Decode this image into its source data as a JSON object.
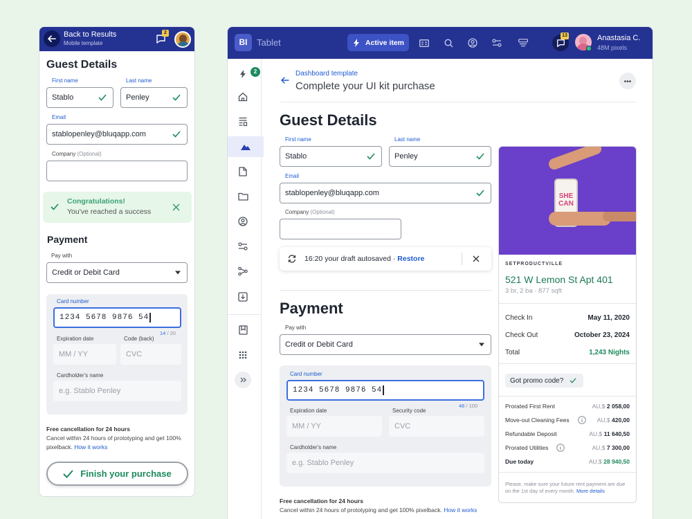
{
  "mobile": {
    "header": {
      "back_label": "Back to Results",
      "subtitle": "Mobile template",
      "badge": "2"
    },
    "title": "Guest Details",
    "form": {
      "first_name_label": "First name",
      "first_name": "Stablo",
      "last_name_label": "Last name",
      "last_name": "Penley",
      "email_label": "Email",
      "email": "stablopenley@bluqapp.com",
      "company_label": "Company",
      "company_optional": "(Optional)"
    },
    "alert": {
      "title": "Congratulations!",
      "message": "You've reached a success"
    },
    "payment": {
      "title": "Payment",
      "pay_with_label": "Pay with",
      "pay_with": "Credit or Debit Card",
      "card_number_label": "Card number",
      "card_number": "1234 5678 9876 54",
      "counter_current": "14",
      "counter_total": "/ 20",
      "expiration_label": "Expiration date",
      "expiration_placeholder": "MM / YY",
      "code_label": "Code (back)",
      "code_placeholder": "CVC",
      "cardholder_label": "Cardholder's name",
      "cardholder_placeholder": "e.g. Stablo Penley"
    },
    "cancellation": {
      "title": "Free cancellation for 24 hours",
      "text": "Cancel within 24 hours of prototyping and get 100% pixelback.",
      "link": "How it works"
    },
    "finish_label": "Finish your purchase"
  },
  "tablet": {
    "header": {
      "logo": "BI",
      "app_name": "Tablet",
      "active_label": "Active item",
      "badge": "13",
      "user_name": "Anastasia C.",
      "user_sub": "48M pixels"
    },
    "sidebar": {
      "badge": "2"
    },
    "breadcrumb": "Dashboard template",
    "page_title": "Complete your UI kit purchase",
    "title": "Guest Details",
    "form": {
      "first_name_label": "First name",
      "first_name": "Stablo",
      "last_name_label": "Last name",
      "last_name": "Penley",
      "email_label": "Email",
      "email": "stablopenley@bluqapp.com",
      "company_label": "Company",
      "company_optional": "(Optional)"
    },
    "autosave": {
      "text": "16:20 your draft autosaved ·",
      "restore": "Restore"
    },
    "payment": {
      "title": "Payment",
      "pay_with_label": "Pay with",
      "pay_with": "Credit or Debit Card",
      "card_number_label": "Card number",
      "card_number": "1234 5678 9876 54",
      "counter_current": "48",
      "counter_total": "/ 100",
      "expiration_label": "Expiration date",
      "expiration_placeholder": "MM / YY",
      "security_label": "Security code",
      "security_placeholder": "CVC",
      "cardholder_label": "Cardholder's name",
      "cardholder_placeholder": "e.g. Stablo Penley"
    },
    "cancellation": {
      "title": "Free cancellation for 24 hours",
      "text": "Cancel within 24 hours of prototyping and get 100% pixelback.",
      "link": "How it works"
    },
    "property": {
      "can_text_1": "SHE",
      "can_text_2": "CAN",
      "brand": "SETPRODUCTVILLE",
      "address": "521 W Lemon St Apt 401",
      "details": "3 br, 2 ba · 877 sqft",
      "check_in_label": "Check In",
      "check_in": "May 11, 2020",
      "check_out_label": "Check Out",
      "check_out": "October 23, 2024",
      "total_label": "Total",
      "total": "1,243 Nights",
      "promo_label": "Got promo code?",
      "fees": [
        {
          "label": "Prorated First Rent",
          "currency": "AU,$",
          "amount": "2 058,00"
        },
        {
          "label": "Move-out Cleaning Fees",
          "currency": "AU,$",
          "amount": "420,00"
        },
        {
          "label": "Refundable Deposit",
          "currency": "AU,$",
          "amount": "11 640,50"
        },
        {
          "label": "Prorated Utilities",
          "currency": "AU,$",
          "amount": "7 300,00"
        },
        {
          "label": "Due today",
          "currency": "AU,$",
          "amount": "28 940,50"
        }
      ],
      "note": "Please, make sure your future rent payment are due on the 1st day of every month.",
      "note_link": "More details"
    }
  },
  "colors": {
    "brand": "#243292",
    "accent": "#1f5bd0",
    "success": "#1d8a5e",
    "purple": "#6a3fc9",
    "bg": "#eaf5ea"
  }
}
